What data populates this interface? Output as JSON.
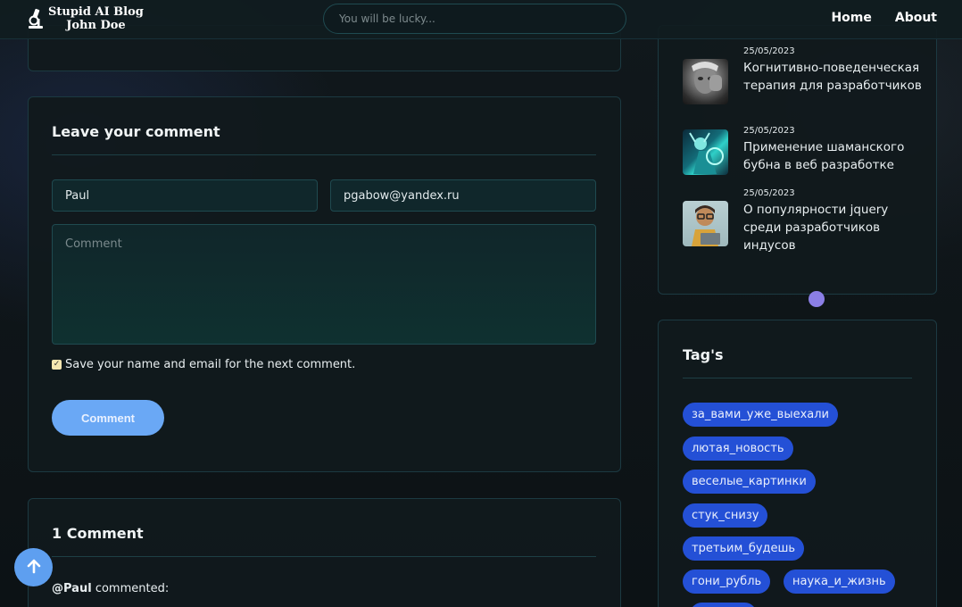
{
  "header": {
    "logo_line1": "Stupid AI Blog",
    "logo_line2": "John Doe",
    "search_placeholder": "You will be lucky...",
    "nav": [
      {
        "label": "Home"
      },
      {
        "label": "About"
      }
    ]
  },
  "comment_form": {
    "title": "Leave your comment",
    "name_value": "Paul",
    "email_value": "pgabow@yandex.ru",
    "comment_placeholder": "Comment",
    "save_label": "Save your name and email for the next comment.",
    "save_checked": true,
    "submit_label": "Comment"
  },
  "comments": {
    "title": "1 Comment",
    "first_author": "@Paul",
    "first_action": "commented:"
  },
  "recent_posts": [
    {
      "date": "25/05/2023",
      "title": "Когнитивно-поведенческая терапия для разработчиков",
      "thumb": "thumb-grayscale-face"
    },
    {
      "date": "25/05/2023",
      "title": "Применение шаманского бубна в веб разработке",
      "thumb": "thumb-teal-shaman"
    },
    {
      "date": "25/05/2023",
      "title": "О популярности jquery среди разработчиков индусов",
      "thumb": "thumb-cartoon-developer"
    }
  ],
  "tags": {
    "title": "Tag's",
    "items": [
      "за_вами_уже_выехали",
      "лютая_новость",
      "веселые_картинки",
      "стук_снизу",
      "третьим_будешь",
      "гони_рубль",
      "наука_и_жизнь"
    ]
  },
  "colors": {
    "accent": "#6aa8f5",
    "tag": "#2450d6",
    "card_border": "#1c3a42"
  }
}
